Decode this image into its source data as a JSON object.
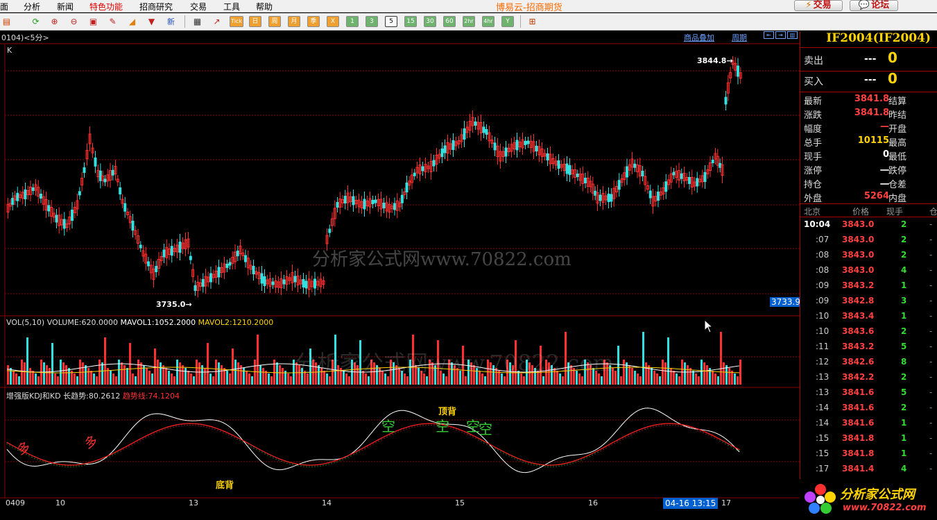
{
  "menu": {
    "items": [
      "面",
      "分析",
      "新闻",
      "特色功能",
      "招商研究",
      "交易",
      "工具",
      "帮助"
    ],
    "highlight": "特色功能"
  },
  "title": "博易云-招商期货",
  "topbuttons": {
    "trade": "交易",
    "forum": "论坛"
  },
  "toolbar": {
    "icons": [
      "chart-icon",
      "refresh-icon",
      "zoom-in-icon",
      "zoom-out-icon",
      "layers-icon",
      "pen-icon",
      "line-draw-icon",
      "filter-icon",
      "new-icon",
      "table-icon",
      "trend-icon",
      "tick-icon"
    ],
    "tick_label": "Tick",
    "periods": [
      "日",
      "周",
      "月",
      "季",
      "X",
      "1",
      "3",
      "5",
      "15",
      "30",
      "60",
      "2hr",
      "4hr",
      "Y"
    ],
    "selected_period": "5",
    "last_icon": "grid-icon"
  },
  "chart": {
    "header_code": "0104)<5分>",
    "main_label": "K",
    "links": {
      "overlay": "商品叠加",
      "period": "周期"
    },
    "high_mark": "3844.8",
    "low_mark": "3735.0",
    "current_price_box": "3733.9",
    "watermark": "分析家公式网www.70822.com",
    "vol": {
      "name": "VOL(5,10)",
      "volume": "VOLUME:620.0000",
      "mavol1": "MAVOL1:1052.2000",
      "mavol2": "MAVOL2:1210.2000"
    },
    "kdj": {
      "name": "增强版KDJ和KD",
      "long": "长趋势:80.2612",
      "trend": "趋势线:74.1204"
    },
    "signals": {
      "bottom_div": "底背",
      "top_div": "顶背",
      "short": "空",
      "long": "多"
    },
    "xaxis": [
      "0409",
      "10",
      "13",
      "14",
      "15",
      "16",
      "17"
    ],
    "cursor_time": "04-16 13:15",
    "colors": {
      "up": "#ff3030",
      "down": "#33e0e0",
      "grid": "#8b0000",
      "ma1": "#ffffff",
      "ma2": "#ffd400"
    }
  },
  "quote": {
    "contract": "IF2004(IF2004)",
    "sell_label": "卖出",
    "sell_price": "---",
    "sell_vol": "0",
    "buy_label": "买入",
    "buy_price": "---",
    "buy_vol": "0",
    "rows": [
      {
        "k": "最新",
        "v": "3841.8",
        "c": "#ff4040",
        "k2": "结算"
      },
      {
        "k": "涨跌",
        "v": "3841.8",
        "c": "#ff4040",
        "k2": "昨结"
      },
      {
        "k": "幅度",
        "v": "—",
        "c": "#ff4040",
        "k2": "开盘"
      },
      {
        "k": "总手",
        "v": "10115",
        "c": "#ffd400",
        "k2": "最高"
      },
      {
        "k": "现手",
        "v": "0",
        "c": "#ffffff",
        "k2": "最低"
      },
      {
        "k": "涨停",
        "v": "一",
        "c": "#ffffff",
        "k2": "跌停"
      },
      {
        "k": "持仓",
        "v": "一",
        "c": "#ffffff",
        "k2": "仓差"
      },
      {
        "k": "外盘",
        "v": "5264",
        "c": "#ff4040",
        "k2": "内盘"
      }
    ],
    "tick_header": {
      "city": "北京",
      "price": "价格",
      "qty": "现手",
      "pos": "仓"
    },
    "ticks": [
      {
        "t": "10:04",
        "p": "3843.0",
        "q": "2"
      },
      {
        "t": ":07",
        "p": "3843.0",
        "q": "2"
      },
      {
        "t": ":08",
        "p": "3843.0",
        "q": "2"
      },
      {
        "t": ":08",
        "p": "3843.0",
        "q": "4"
      },
      {
        "t": ":09",
        "p": "3843.2",
        "q": "1"
      },
      {
        "t": ":09",
        "p": "3842.8",
        "q": "3"
      },
      {
        "t": ":10",
        "p": "3843.4",
        "q": "1"
      },
      {
        "t": ":10",
        "p": "3843.6",
        "q": "2"
      },
      {
        "t": ":11",
        "p": "3843.2",
        "q": "5"
      },
      {
        "t": ":12",
        "p": "3842.6",
        "q": "8"
      },
      {
        "t": ":13",
        "p": "3842.2",
        "q": "2"
      },
      {
        "t": ":13",
        "p": "3841.6",
        "q": "5"
      },
      {
        "t": ":14",
        "p": "3841.6",
        "q": "2"
      },
      {
        "t": ":14",
        "p": "3841.6",
        "q": "1"
      },
      {
        "t": ":15",
        "p": "3841.8",
        "q": "1"
      },
      {
        "t": ":15",
        "p": "3841.8",
        "q": "1"
      },
      {
        "t": ":17",
        "p": "3841.4",
        "q": "4"
      }
    ]
  },
  "logo": {
    "text": "分析家公式网",
    "url": "www.70822.com"
  }
}
